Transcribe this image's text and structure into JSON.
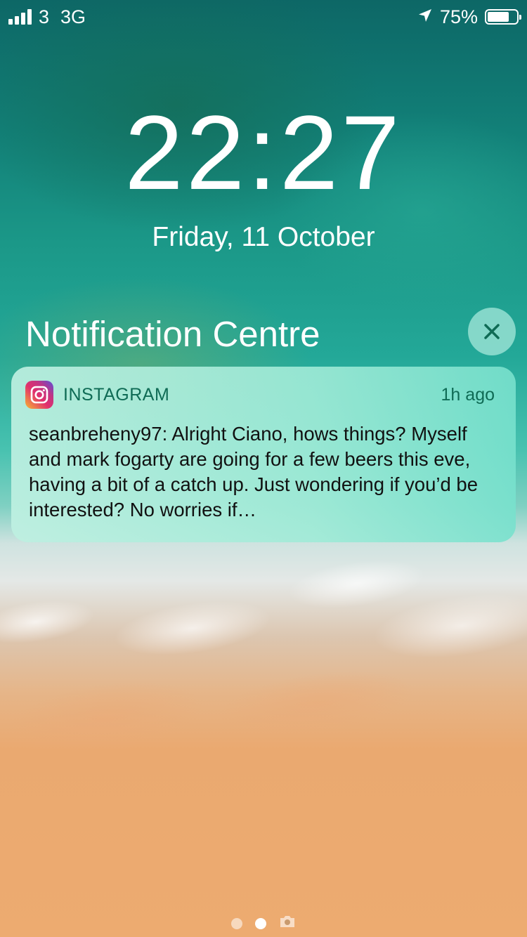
{
  "status_bar": {
    "signal_bars": 4,
    "carrier": "3",
    "network": "3G",
    "icons": [
      "signal-icon",
      "location-arrow-icon",
      "battery-icon"
    ],
    "battery_percent": "75%",
    "battery_level": 0.75
  },
  "lock_screen": {
    "time": "22:27",
    "date": "Friday, 11 October"
  },
  "notification_centre": {
    "title": "Notification Centre",
    "clear_icon": "close-icon",
    "notifications": [
      {
        "app": "INSTAGRAM",
        "app_icon": "instagram-icon",
        "time": "1h ago",
        "body": "seanbreheny97: Alright Ciano, hows things? Myself and mark fogarty are going for a few beers this eve, having a bit of a catch up. Just wondering if you’d be interested? No worries if…"
      }
    ]
  },
  "page_indicator": {
    "dots": 2,
    "active_index": 1,
    "camera_icon": "camera-icon"
  },
  "colors": {
    "notification_app_text": "#0f6b55",
    "clear_button_bg": "#96e1d2"
  }
}
